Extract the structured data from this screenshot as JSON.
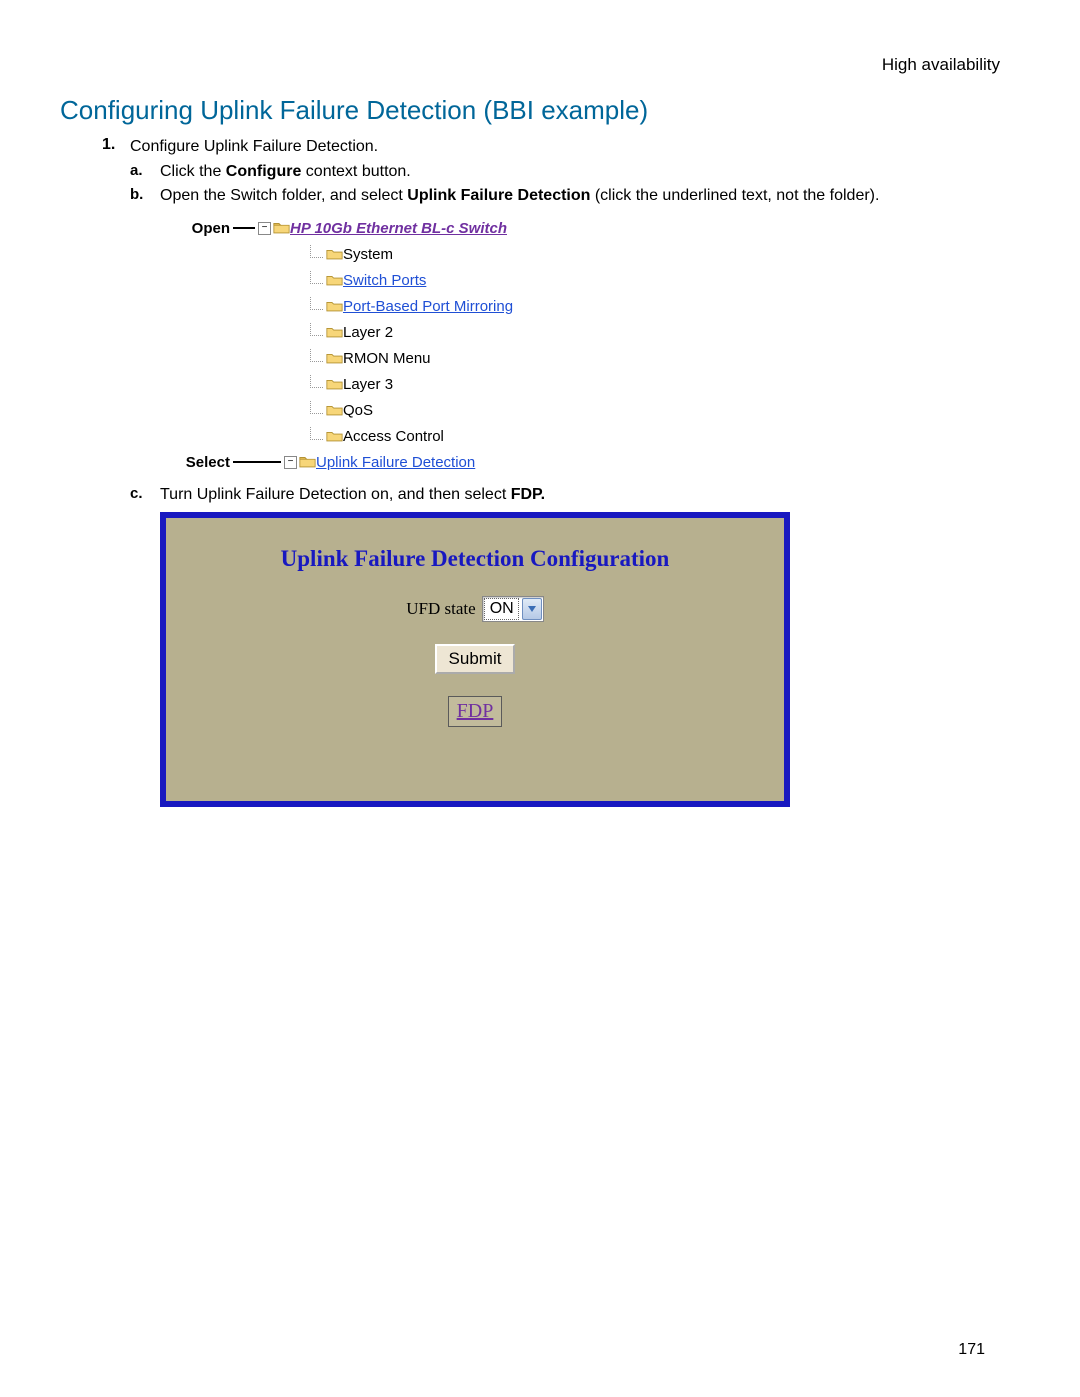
{
  "header_right": "High availability",
  "section_title": "Configuring Uplink Failure Detection (BBI example)",
  "step1_text": "Configure Uplink Failure Detection.",
  "sub_a_pre": "Click the ",
  "sub_a_bold": "Configure",
  "sub_a_post": " context button.",
  "sub_b_pre": "Open the Switch folder, and select ",
  "sub_b_bold": "Uplink Failure Detection",
  "sub_b_post": " (click the underlined text, not the folder).",
  "sub_c_pre": "Turn Uplink Failure Detection on, and then select ",
  "sub_c_bold": "FDP.",
  "tree": {
    "open_label": "Open",
    "select_label": "Select",
    "root": "HP 10Gb Ethernet BL-c Switch",
    "items": [
      {
        "label": "System",
        "link": false
      },
      {
        "label": "Switch Ports",
        "link": true
      },
      {
        "label": "Port-Based Port Mirroring",
        "link": true
      },
      {
        "label": "Layer 2",
        "link": false
      },
      {
        "label": "RMON Menu",
        "link": false
      },
      {
        "label": "Layer 3",
        "link": false
      },
      {
        "label": "QoS",
        "link": false
      },
      {
        "label": "Access Control",
        "link": false
      }
    ],
    "last": "Uplink Failure Detection"
  },
  "ufd": {
    "title": "Uplink Failure Detection Configuration",
    "label": "UFD state",
    "value": "ON",
    "submit": "Submit",
    "fdp": "FDP"
  },
  "page_num": "171"
}
